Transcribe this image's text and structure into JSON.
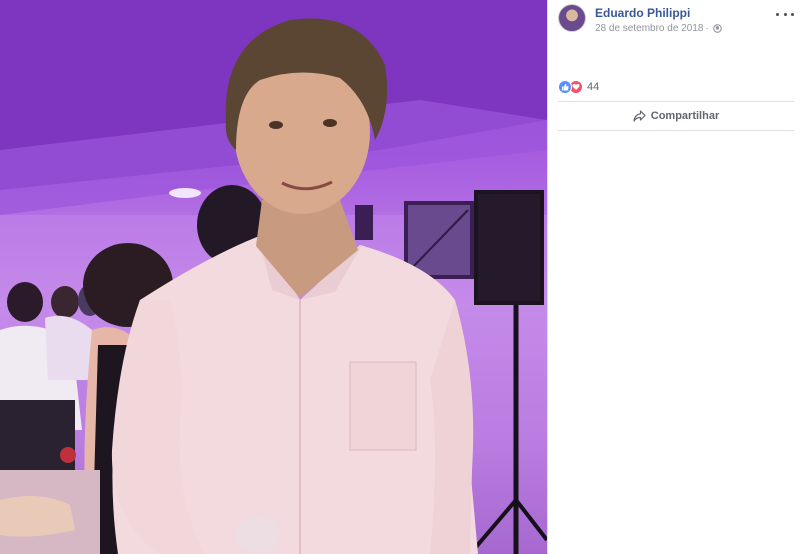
{
  "post": {
    "author": "Eduardo Philippi",
    "date": "28 de setembro de 2018",
    "date_separator": "·",
    "privacy_icon": "globe-icon",
    "reaction_count": "44",
    "reactions": [
      "like-icon",
      "love-icon"
    ],
    "share_label": "Compartilhar"
  },
  "colors": {
    "author_link": "#385898",
    "like": "#5890ff",
    "love": "#f25268",
    "meta_text": "#90949c"
  }
}
